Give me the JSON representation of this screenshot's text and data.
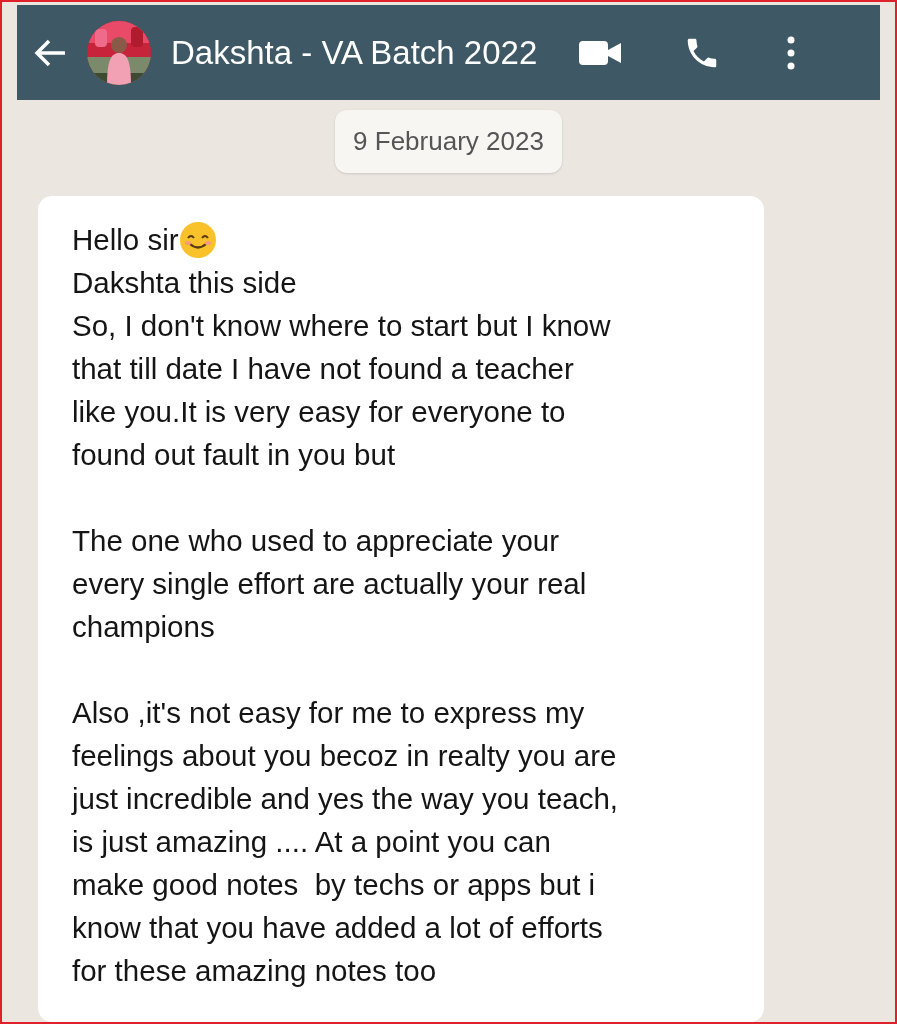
{
  "header": {
    "title": "Dakshta - VA Batch 2022"
  },
  "date_chip": "9 February 2023",
  "message": {
    "greeting": {
      "text": "Hello sir",
      "emoji": true
    },
    "paragraphs": [
      "Dakshta this side\nSo, I don't know where to start but I know\nthat till date I have not found a teacher\nlike you.It is very easy for everyone to\nfound out fault in you but",
      "The one who used to appreciate your\nevery single effort are actually your real\nchampions",
      "Also ,it's not easy for me to express my\nfeelings about you becoz in realty you are\njust incredible and yes the way you teach,\nis just amazing .... At a point you can\nmake good notes  by techs or apps but i\nknow that you have added a lot of efforts\nfor these amazing notes too"
    ]
  }
}
